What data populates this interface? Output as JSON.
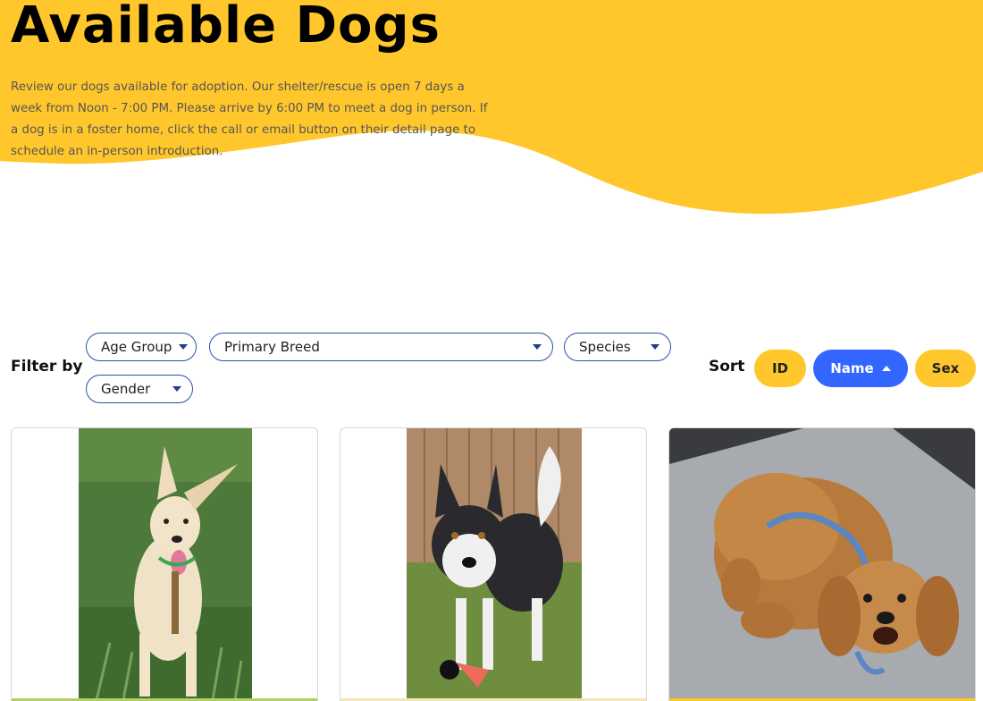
{
  "hero": {
    "title": "Available Dogs",
    "description": "Review our dogs available for adoption. Our shelter/rescue is open 7 days a week from Noon - 7:00 PM. Please arrive by 6:00 PM to meet a dog in person. If a dog is in a foster home, click the call or email button on their detail page to schedule an in-person introduction."
  },
  "filters": {
    "label": "Filter by",
    "age_group": "Age Group",
    "primary_breed": "Primary Breed",
    "species": "Species",
    "gender": "Gender"
  },
  "sort": {
    "label": "Sort",
    "id": "ID",
    "name": "Name",
    "sex": "Sex"
  },
  "cards": [
    {
      "accent": "#b5cf5e"
    },
    {
      "accent": "#f2e6b8"
    },
    {
      "accent": "#ffc72c"
    }
  ],
  "colors": {
    "brand_yellow": "#ffc72c",
    "primary_blue": "#3366ff",
    "select_border": "#2b4fa8"
  }
}
